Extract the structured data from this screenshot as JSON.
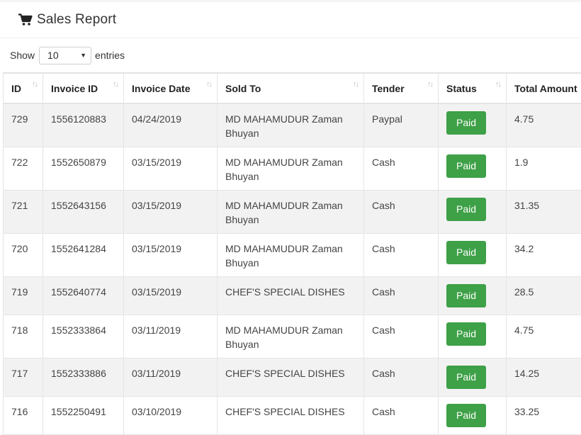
{
  "header": {
    "title": "Sales Report",
    "icon": "cart-icon"
  },
  "length_control": {
    "prefix": "Show",
    "value": "10",
    "suffix": "entries"
  },
  "table": {
    "columns": [
      "ID",
      "Invoice ID",
      "Invoice Date",
      "Sold To",
      "Tender",
      "Status",
      "Total Amount"
    ],
    "rows": [
      {
        "id": "729",
        "invoice": "1556120883",
        "date": "04/24/2019",
        "sold_to": "MD MAHAMUDUR Zaman Bhuyan",
        "tender": "Paypal",
        "status": "Paid",
        "total": "4.75"
      },
      {
        "id": "722",
        "invoice": "1552650879",
        "date": "03/15/2019",
        "sold_to": "MD MAHAMUDUR Zaman Bhuyan",
        "tender": "Cash",
        "status": "Paid",
        "total": "1.9"
      },
      {
        "id": "721",
        "invoice": "1552643156",
        "date": "03/15/2019",
        "sold_to": "MD MAHAMUDUR Zaman Bhuyan",
        "tender": "Cash",
        "status": "Paid",
        "total": "31.35"
      },
      {
        "id": "720",
        "invoice": "1552641284",
        "date": "03/15/2019",
        "sold_to": "MD MAHAMUDUR Zaman Bhuyan",
        "tender": "Cash",
        "status": "Paid",
        "total": "34.2"
      },
      {
        "id": "719",
        "invoice": "1552640774",
        "date": "03/15/2019",
        "sold_to": "CHEF'S SPECIAL DISHES",
        "tender": "Cash",
        "status": "Paid",
        "total": "28.5"
      },
      {
        "id": "718",
        "invoice": "1552333864",
        "date": "03/11/2019",
        "sold_to": "MD MAHAMUDUR Zaman Bhuyan",
        "tender": "Cash",
        "status": "Paid",
        "total": "4.75"
      },
      {
        "id": "717",
        "invoice": "1552333886",
        "date": "03/11/2019",
        "sold_to": "CHEF'S SPECIAL DISHES",
        "tender": "Cash",
        "status": "Paid",
        "total": "14.25"
      },
      {
        "id": "716",
        "invoice": "1552250491",
        "date": "03/10/2019",
        "sold_to": "CHEF'S SPECIAL DISHES",
        "tender": "Cash",
        "status": "Paid",
        "total": "33.25"
      }
    ]
  },
  "colors": {
    "paid_badge": "#3ea047",
    "stripe": "#f2f2f2"
  }
}
